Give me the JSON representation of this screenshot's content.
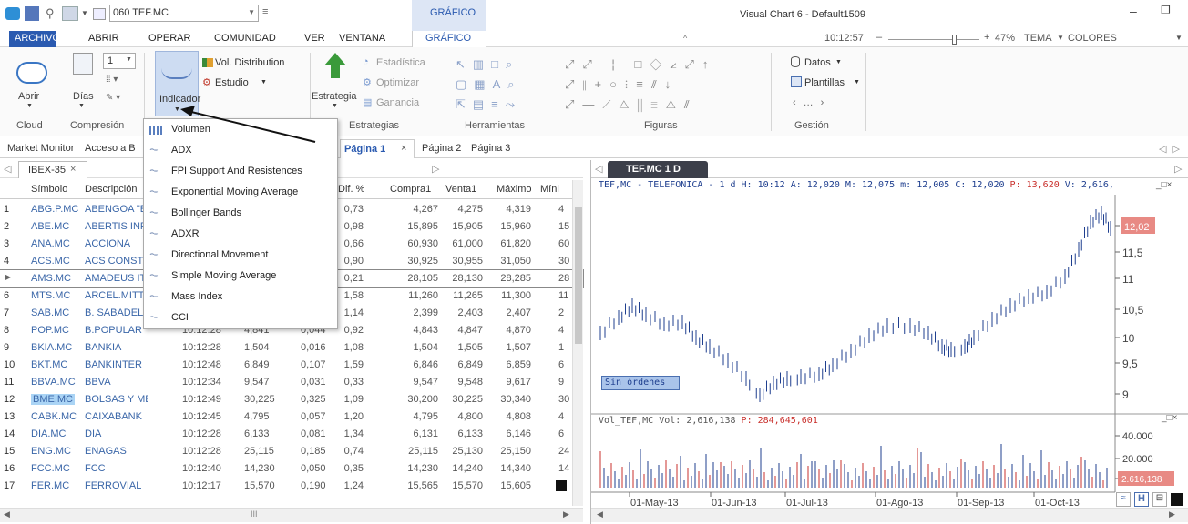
{
  "titlebar": {
    "symbol_box": "060 TEF.MC",
    "context_tab": "GRÁFICO",
    "window_title": "Visual Chart 6 - Default1509"
  },
  "menubar": {
    "items": [
      "ARCHIVO",
      "ABRIR",
      "OPERAR",
      "COMUNIDAD",
      "VER",
      "VENTANA",
      "GRÁFICO"
    ],
    "time": "10:12:57",
    "zoom": "47%",
    "tema": "TEMA",
    "colores": "COLORES"
  },
  "ribbon": {
    "cloud": {
      "abrir": "Abrir",
      "group": "Cloud"
    },
    "compresion": {
      "value": "1",
      "dias": "Días",
      "group": "Compresión"
    },
    "indicador": "Indicador",
    "vol_distribution": "Vol. Distribution",
    "estudio": "Estudio",
    "estrategia": "Estrategia",
    "estrategias_group": "Estrategias",
    "estadistica": "Estadística",
    "optimizar": "Optimizar",
    "ganancia": "Ganancia",
    "herramientas_group": "Herramientas",
    "figuras_group": "Figuras",
    "datos": "Datos",
    "plantillas": "Plantillas",
    "gestion_group": "Gestión"
  },
  "tabs": {
    "market_monitor": "Market Monitor",
    "acceso": "Acceso a B",
    "pagina1": "Página 1",
    "pagina2": "Página 2",
    "pagina3": "Página 3",
    "ibex": "IBEX-35",
    "chart_tab": "TEF.MC 1 D"
  },
  "dropdown": [
    "Volumen",
    "ADX",
    "FPI Support And Resistences",
    "Exponential Moving Average",
    "Bollinger Bands",
    "ADXR",
    "Directional Movement",
    "Simple Moving Average",
    "Mass Index",
    "CCI"
  ],
  "grid": {
    "headers": [
      "Símbolo",
      "Descripción",
      "Hora",
      "Último",
      "Dif.",
      "Dif. %",
      "Compra1",
      "Venta1",
      "Máximo",
      "Míni"
    ],
    "rows": [
      [
        "1",
        "ABG.P.MC",
        "ABENGOA \"E",
        "",
        "",
        "",
        "0,73",
        "4,267",
        "4,275",
        "4,319",
        "4"
      ],
      [
        "2",
        "ABE.MC",
        "ABERTIS INFR",
        "",
        "",
        "",
        "0,98",
        "15,895",
        "15,905",
        "15,960",
        "15"
      ],
      [
        "3",
        "ANA.MC",
        "ACCIONA",
        "",
        "",
        "",
        "0,66",
        "60,930",
        "61,000",
        "61,820",
        "60"
      ],
      [
        "4",
        "ACS.MC",
        "ACS CONST.",
        "",
        "",
        "",
        "0,90",
        "30,925",
        "30,955",
        "31,050",
        "30"
      ],
      [
        "",
        "AMS.MC",
        "AMADEUS IT",
        "",
        "",
        "",
        "0,21",
        "28,105",
        "28,130",
        "28,285",
        "28"
      ],
      [
        "6",
        "MTS.MC",
        "ARCEL.MITTA",
        "",
        "",
        "",
        "1,58",
        "11,260",
        "11,265",
        "11,300",
        "11"
      ],
      [
        "7",
        "SAB.MC",
        "B. SABADELL",
        "",
        "",
        "",
        "1,14",
        "2,399",
        "2,403",
        "2,407",
        "2"
      ],
      [
        "8",
        "POP.MC",
        "B.POPULAR",
        "10:12:28",
        "4,841",
        "0,044",
        "0,92",
        "4,843",
        "4,847",
        "4,870",
        "4"
      ],
      [
        "9",
        "BKIA.MC",
        "BANKIA",
        "10:12:28",
        "1,504",
        "0,016",
        "1,08",
        "1,504",
        "1,505",
        "1,507",
        "1"
      ],
      [
        "10",
        "BKT.MC",
        "BANKINTER",
        "10:12:48",
        "6,849",
        "0,107",
        "1,59",
        "6,846",
        "6,849",
        "6,859",
        "6"
      ],
      [
        "11",
        "BBVA.MC",
        "BBVA",
        "10:12:34",
        "9,547",
        "0,031",
        "0,33",
        "9,547",
        "9,548",
        "9,617",
        "9"
      ],
      [
        "12",
        "BME.MC",
        "BOLSAS Y MER",
        "10:12:49",
        "30,225",
        "0,325",
        "1,09",
        "30,200",
        "30,225",
        "30,340",
        "30"
      ],
      [
        "13",
        "CABK.MC",
        "CAIXABANK",
        "10:12:45",
        "4,795",
        "0,057",
        "1,20",
        "4,795",
        "4,800",
        "4,808",
        "4"
      ],
      [
        "14",
        "DIA.MC",
        "DIA",
        "10:12:28",
        "6,133",
        "0,081",
        "1,34",
        "6,131",
        "6,133",
        "6,146",
        "6"
      ],
      [
        "15",
        "ENG.MC",
        "ENAGAS",
        "10:12:28",
        "25,115",
        "0,185",
        "0,74",
        "25,115",
        "25,130",
        "25,150",
        "24"
      ],
      [
        "16",
        "FCC.MC",
        "FCC",
        "10:12:40",
        "14,230",
        "0,050",
        "0,35",
        "14,230",
        "14,240",
        "14,340",
        "14"
      ],
      [
        "17",
        "FER.MC",
        "FERROVIAL",
        "10:12:17",
        "15,570",
        "0,190",
        "1,24",
        "15,565",
        "15,570",
        "15,605",
        ""
      ]
    ],
    "scroll_mark": "III"
  },
  "chart": {
    "header_prefix": "TEF,MC - TELEFONICA -  1 d H: 10:12 A: 12,020 M: 12,075 m: 12,005 C: 12,020 ",
    "header_p_label": "P",
    "header_p_value": ": 13,620",
    "header_suffix": " V: 2,616,",
    "price_axis": [
      "12,02",
      "11,5",
      "11",
      "10,5",
      "10",
      "9,5",
      "9"
    ],
    "sin_ordenes": "Sin órdenes",
    "vol_header": "Vol_TEF,MC Vol: 2,616,138 ",
    "vol_p": "P: 284,645,601",
    "vol_axis": [
      "40.000",
      "20.000",
      "2.616,138"
    ],
    "dates": [
      "01-May-13",
      "01-Jun-13",
      "01-Jul-13",
      "01-Ago-13",
      "01-Sep-13",
      "01-Oct-13"
    ],
    "accent": "#c9302c",
    "blue": "#1f3f8f"
  }
}
